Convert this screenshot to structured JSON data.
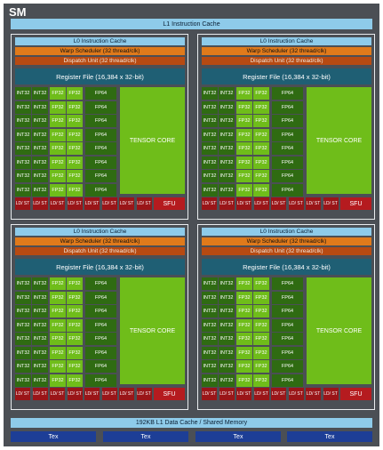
{
  "sm": {
    "title": "SM",
    "l1_instruction_cache": "L1 Instruction Cache",
    "l1_data_cache": "192KB L1 Data Cache / Shared Memory",
    "tex_units": [
      "Tex",
      "Tex",
      "Tex",
      "Tex"
    ]
  },
  "partition": {
    "l0_cache": "L0 Instruction Cache",
    "warp_scheduler": "Warp Scheduler (32 thread/clk)",
    "dispatch_unit": "Dispatch Unit (32 thread/clk)",
    "register_file": "Register File (16,384 x 32-bit)",
    "int32_label": "INT32",
    "fp32_label": "FP32",
    "fp64_label": "FP64",
    "tensor_core": "TENSOR CORE",
    "ldst_label": "LD/ ST",
    "sfu": "SFU",
    "rows": 8,
    "ldst_units": 8
  },
  "colors": {
    "frame": "#4b4f55",
    "cache": "#8ecbea",
    "warp": "#e07a1b",
    "dispatch": "#b74a12",
    "register": "#1f5f74",
    "int32": "#2f6b12",
    "fp32": "#6fbd1a",
    "ldst": "#9a1518",
    "tex": "#1d3e96"
  }
}
